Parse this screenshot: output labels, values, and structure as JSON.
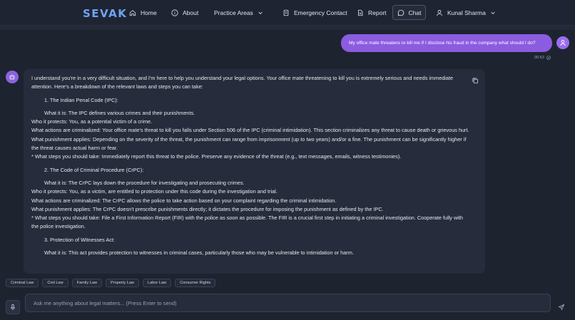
{
  "nav": {
    "brand": "SEVAK",
    "home": "Home",
    "about": "About",
    "practice": "Practice Areas",
    "emergency": "Emergency Contact",
    "report": "Report",
    "chat": "Chat",
    "user": "Kunal Sharma"
  },
  "user_message": {
    "text": "My office mate threatens to kill me if I disclose his fraud in the company what should I do?",
    "time": "00:53"
  },
  "bot_message": {
    "intro": "I understand you're in a very difficult situation, and I'm here to help you understand your legal options. Your office mate threatening to kill you is extremely serious and needs immediate attention. Here's a breakdown of the relevant laws and steps you can take:",
    "s1_title": "1. The Indian Penal Code (IPC):",
    "s1_what": "What it is: The IPC defines various crimes and their punishments.",
    "s1_protects": "Who it protects: You, as a potential victim of a crime.",
    "s1_actions": "What actions are criminalized: Your office mate's threat to kill you falls under Section 506 of the IPC (criminal intimidation). This section criminalizes any threat to cause death or grievous hurt.",
    "s1_punish": "What punishment applies: Depending on the severity of the threat, the punishment can range from imprisonment (up to two years) and/or a fine. The punishment can be significantly higher if the threat causes actual harm or fear.",
    "s1_steps": "* What steps you should take: Immediately report this threat to the police. Preserve any evidence of the threat (e.g., text messages, emails, witness testimonies).",
    "s2_title": "2. The Code of Criminal Procedure (CrPC):",
    "s2_what": "What it is: The CrPC lays down the procedure for investigating and prosecuting crimes.",
    "s2_protects": "Who it protects: You, as a victim, are entitled to protection under this code during the investigation and trial.",
    "s2_actions": "What actions are criminalized: The CrPC allows the police to take action based on your complaint regarding the criminal intimidation.",
    "s2_punish": "What punishment applies: The CrPC doesn't prescribe punishments directly; it dictates the procedure for imposing the punishment as defined by the IPC.",
    "s2_steps": "* What steps you should take: File a First Information Report (FIR) with the police as soon as possible. The FIR is a crucial first step in initiating a criminal investigation. Cooperate fully with the police investigation.",
    "s3_title": "3. Protection of Witnesses Act:",
    "s3_what": "What it is: This act provides protection to witnesses in criminal cases, particularly those who may be vulnerable to intimidation or harm."
  },
  "chips": [
    "Criminal Law",
    "Civil Law",
    "Family Law",
    "Property Law",
    "Labor Law",
    "Consumer Rights"
  ],
  "input": {
    "placeholder": "Ask me anything about legal matters... (Press Enter to send)"
  },
  "colors": {
    "background": "#1e2330",
    "brand": "#6ea5f3",
    "user_bubble": "#8b5ce0",
    "card": "#262c3b"
  }
}
